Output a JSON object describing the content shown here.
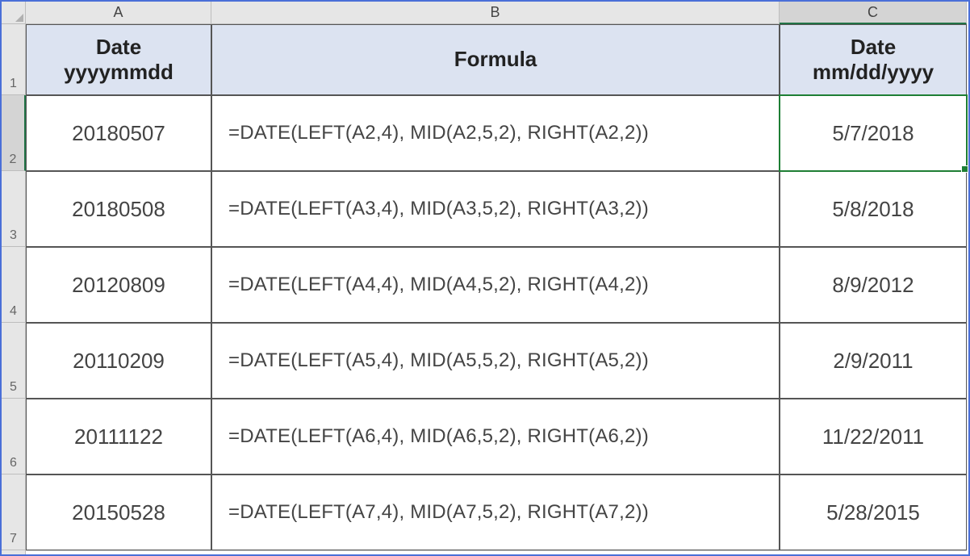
{
  "columns": {
    "A": "A",
    "B": "B",
    "C": "C"
  },
  "row_labels": [
    "1",
    "2",
    "3",
    "4",
    "5",
    "6",
    "7"
  ],
  "headers": {
    "A": "Date\nyyyymmdd",
    "B": "Formula",
    "C": "Date\nmm/dd/yyyy"
  },
  "rows": [
    {
      "A": "20180507",
      "B": "=DATE(LEFT(A2,4), MID(A2,5,2), RIGHT(A2,2))",
      "C": "5/7/2018"
    },
    {
      "A": "20180508",
      "B": "=DATE(LEFT(A3,4), MID(A3,5,2), RIGHT(A3,2))",
      "C": "5/8/2018"
    },
    {
      "A": "20120809",
      "B": "=DATE(LEFT(A4,4), MID(A4,5,2), RIGHT(A4,2))",
      "C": "8/9/2012"
    },
    {
      "A": "20110209",
      "B": "=DATE(LEFT(A5,4), MID(A5,5,2), RIGHT(A5,2))",
      "C": "2/9/2011"
    },
    {
      "A": "20111122",
      "B": "=DATE(LEFT(A6,4), MID(A6,5,2), RIGHT(A6,2))",
      "C": "11/22/2011"
    },
    {
      "A": "20150528",
      "B": "=DATE(LEFT(A7,4), MID(A7,5,2), RIGHT(A7,2))",
      "C": "5/28/2015"
    }
  ],
  "selected_cell": "C2"
}
